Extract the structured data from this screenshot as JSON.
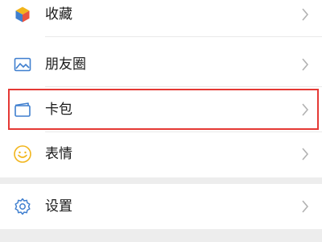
{
  "menu": {
    "items": [
      {
        "label": "收藏",
        "icon": "cube-icon"
      },
      {
        "label": "朋友圈",
        "icon": "image-icon"
      },
      {
        "label": "卡包",
        "icon": "card-wallet-icon",
        "highlighted": true
      },
      {
        "label": "表情",
        "icon": "smiley-icon"
      }
    ],
    "settings": {
      "label": "设置",
      "icon": "gear-icon"
    }
  },
  "colors": {
    "highlight_border": "#e53935",
    "icon_blue": "#3f7fcf",
    "icon_yellow": "#f2b51b",
    "chevron": "#b2b2b2",
    "background": "#ededed",
    "text": "#191919"
  }
}
